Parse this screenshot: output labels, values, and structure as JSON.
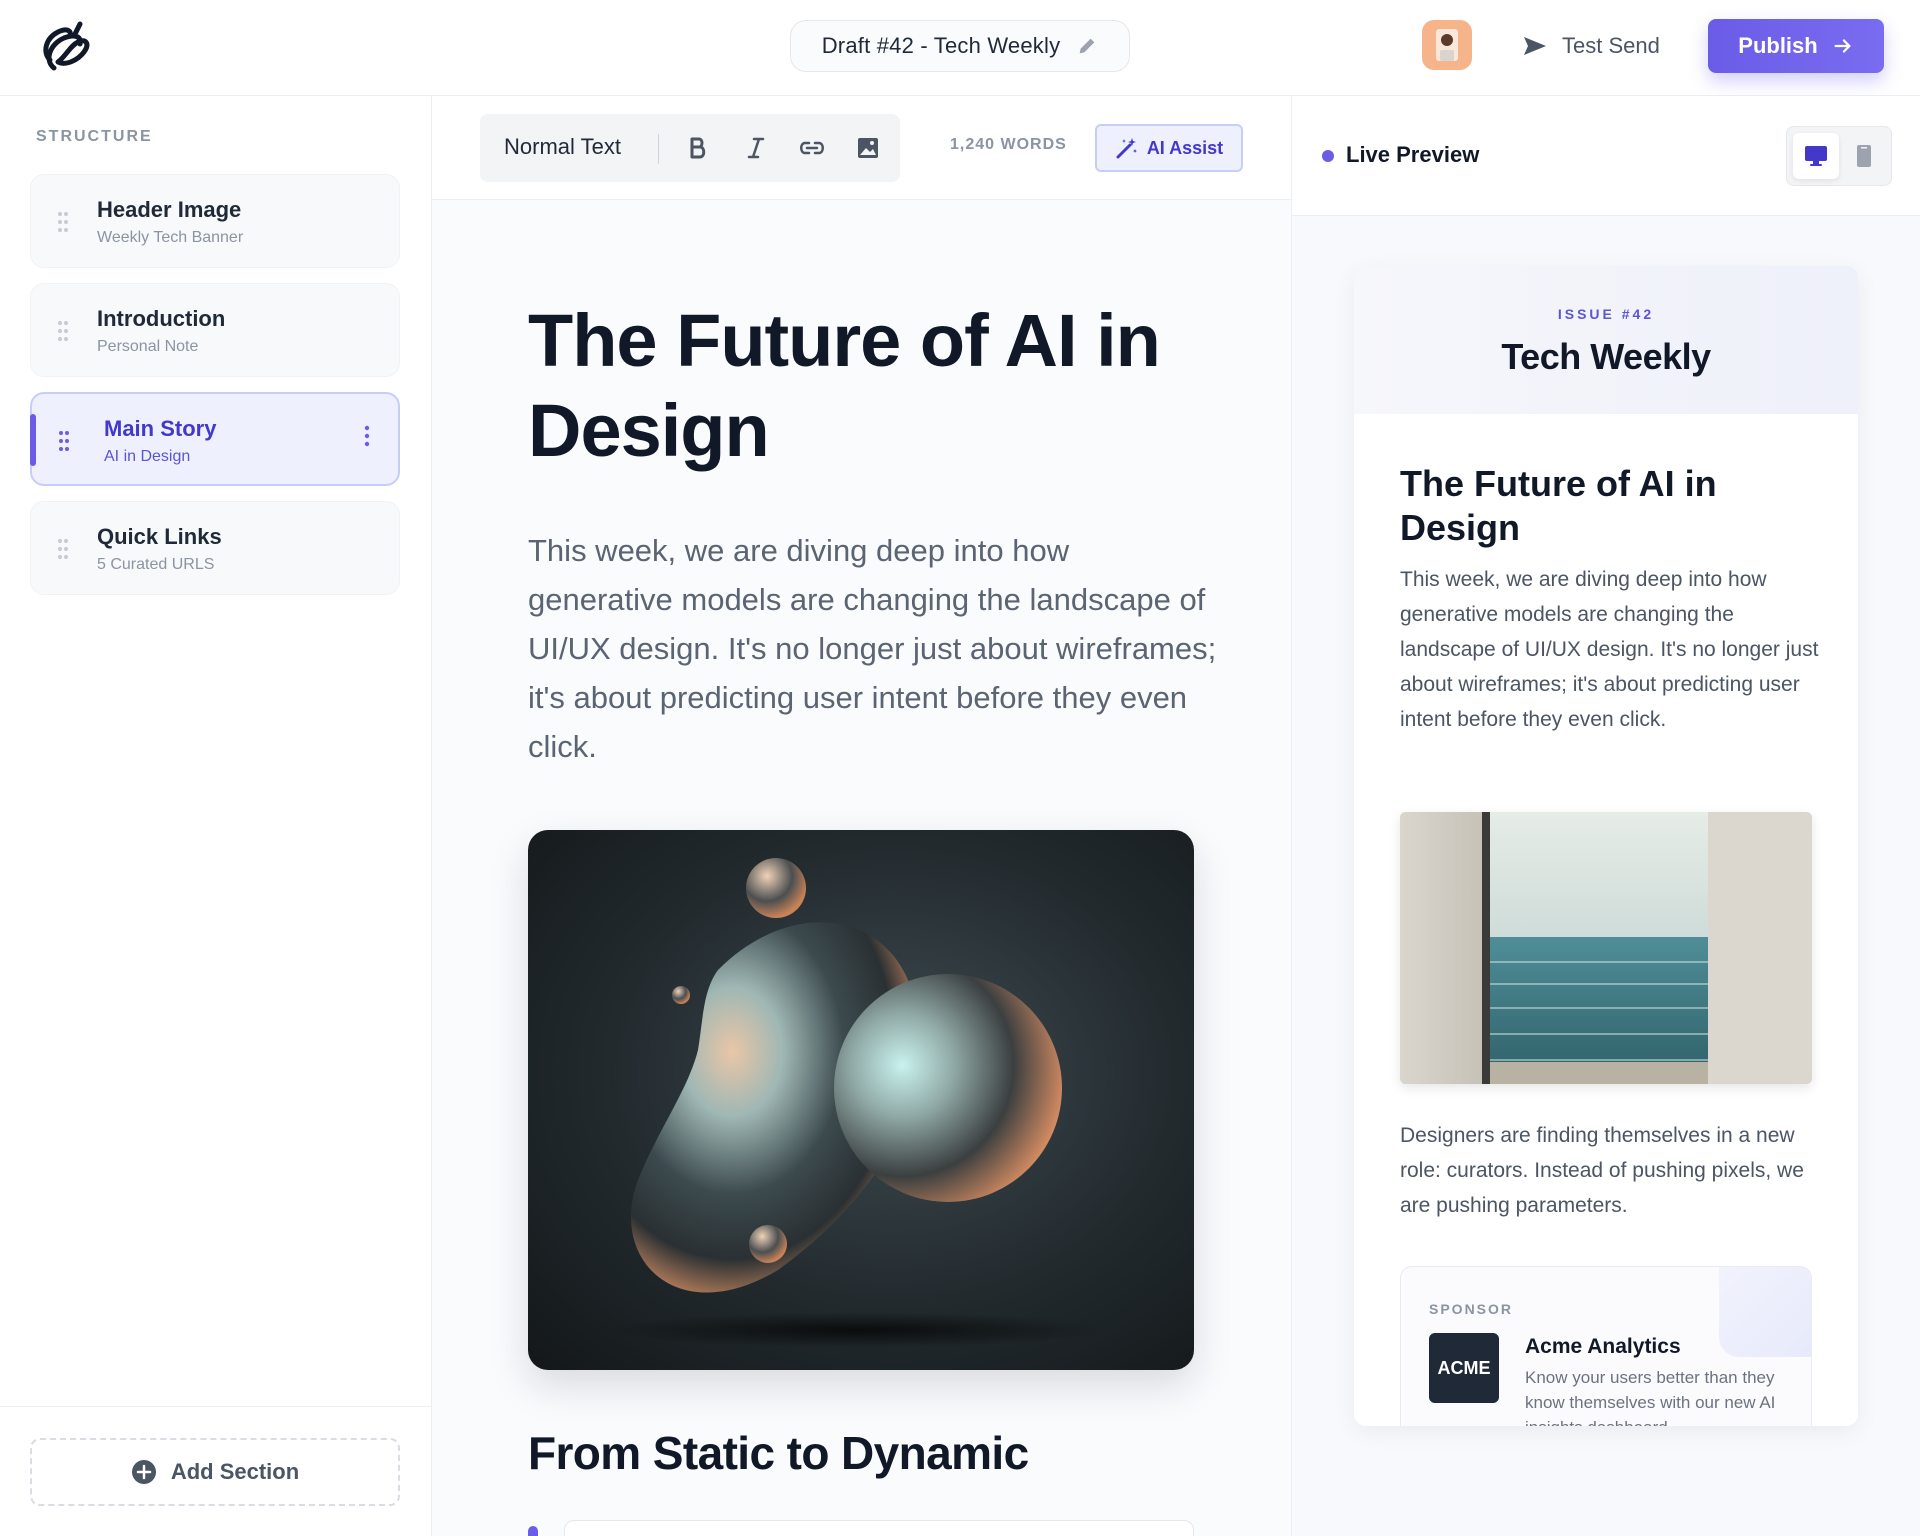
{
  "header": {
    "logo_icon": "brand-logo-icon",
    "draft_title": "Draft #42 - Tech Weekly",
    "test_send_label": "Test Send",
    "publish_label": "Publish"
  },
  "sidebar": {
    "title": "STRUCTURE",
    "sections": [
      {
        "name": "Header Image",
        "sub": "Weekly Tech Banner",
        "active": false
      },
      {
        "name": "Introduction",
        "sub": "Personal Note",
        "active": false
      },
      {
        "name": "Main Story",
        "sub": "AI in Design",
        "active": true
      },
      {
        "name": "Quick Links",
        "sub": "5 Curated URLS",
        "active": false
      }
    ],
    "add_section_label": "Add Section"
  },
  "editor": {
    "text_style": "Normal Text",
    "word_count": "1,240 WORDS",
    "ai_assist_label": "AI Assist",
    "title": "The Future of AI in Design",
    "intro": "This week, we are diving deep into how generative models are changing the landscape of UI/UX design. It's no longer just about wireframes; it's about predicting user intent before they even click.",
    "subheading": "From Static to Dynamic"
  },
  "preview": {
    "label": "Live Preview",
    "issue": "ISSUE #42",
    "newsletter_name": "Tech Weekly",
    "title": "The Future of AI in Design",
    "intro": "This week, we are diving deep into how generative models are changing the landscape of UI/UX design. It's no longer just about wireframes; it's about predicting user intent before they even click.",
    "body2": "Designers are finding themselves in a new role: curators. Instead of pushing pixels, we are pushing parameters.",
    "sponsor": {
      "label": "SPONSOR",
      "logo_text": "ACME",
      "name": "Acme Analytics",
      "desc": "Know your users better than they know themselves with our new AI insights dashboard."
    }
  },
  "colors": {
    "accent": "#6b5ce7",
    "accent_dark": "#4338ca",
    "text_primary": "#111827",
    "text_muted": "#8a94a3"
  }
}
